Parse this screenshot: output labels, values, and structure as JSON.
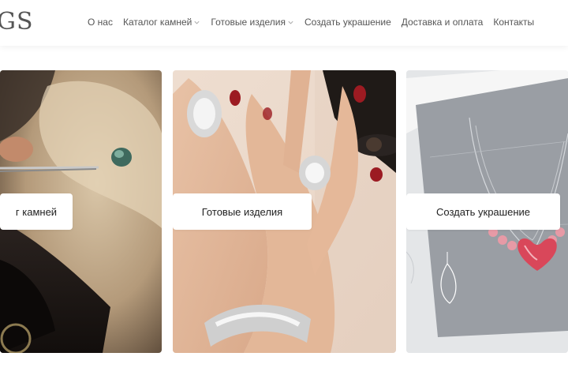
{
  "site": {
    "logo_text": "GS"
  },
  "nav": {
    "items": [
      {
        "label": "О нас",
        "has_dropdown": false
      },
      {
        "label": "Каталог камней",
        "has_dropdown": true
      },
      {
        "label": "Готовые изделия",
        "has_dropdown": true
      },
      {
        "label": "Создать украшение",
        "has_dropdown": false
      },
      {
        "label": "Доставка и оплата",
        "has_dropdown": false
      },
      {
        "label": "Контакты",
        "has_dropdown": false
      }
    ]
  },
  "cards": [
    {
      "label": "г камней",
      "image": "jeweler tweezers holding a green gemstone over beige fabric"
    },
    {
      "label": "Готовые изделия",
      "image": "woman's hands with diamond rings and bracelet, red nails"
    },
    {
      "label": "Создать украшение",
      "image": "jewelry design sketches of a necklace with pink heart stone"
    }
  ],
  "colors": {
    "accent_red": "#9c1b22",
    "text": "#555555",
    "background": "#ffffff"
  }
}
